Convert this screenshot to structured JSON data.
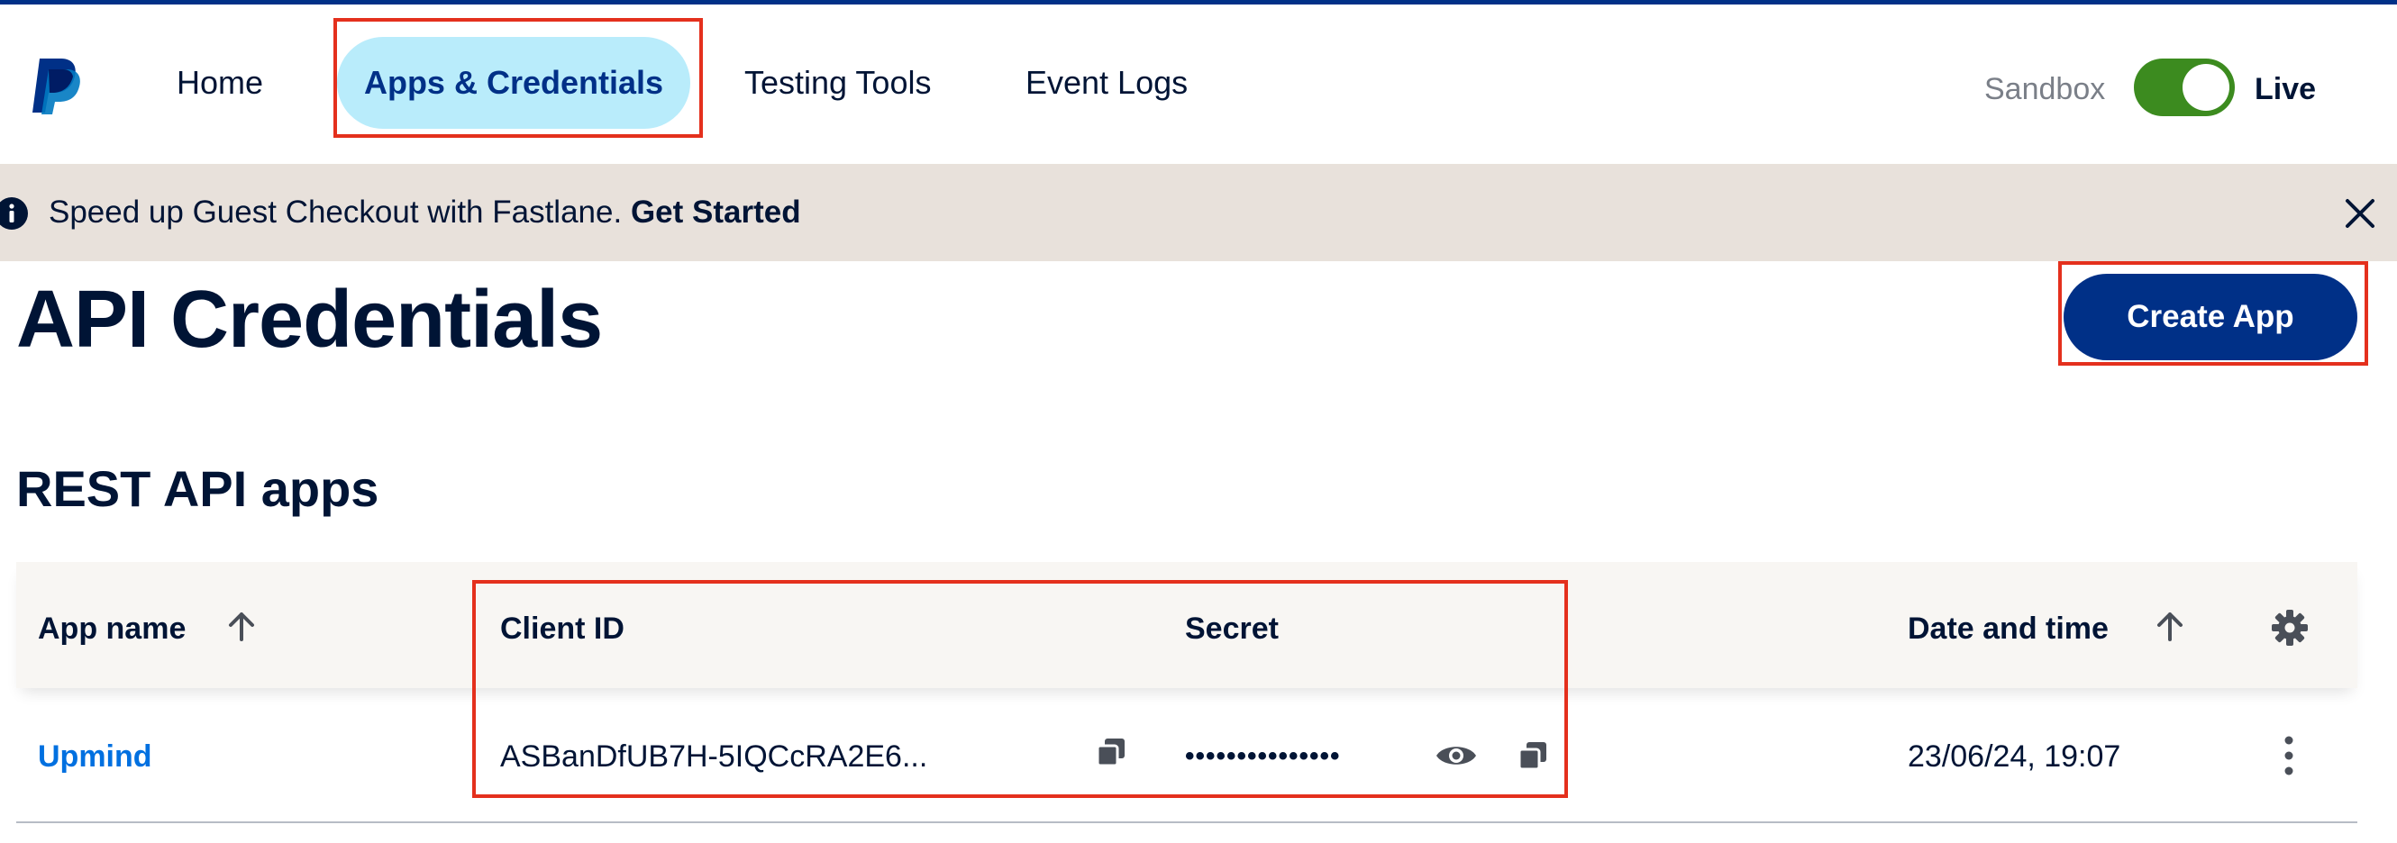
{
  "nav": {
    "items": [
      {
        "label": "Home"
      },
      {
        "label": "Apps & Credentials",
        "active": true
      },
      {
        "label": "Testing Tools"
      },
      {
        "label": "Event Logs"
      }
    ]
  },
  "environment": {
    "sandbox_label": "Sandbox",
    "live_label": "Live",
    "selected": "Live"
  },
  "banner": {
    "text": "Speed up Guest Checkout with Fastlane. ",
    "link": "Get Started"
  },
  "page": {
    "title": "API Credentials",
    "create_button": "Create App",
    "section_title": "REST API apps"
  },
  "table": {
    "headers": {
      "app_name": "App name",
      "client_id": "Client ID",
      "secret": "Secret",
      "date_time": "Date and time"
    },
    "rows": [
      {
        "app_name": "Upmind",
        "client_id": "ASBanDfUB7H-5IQCcRA2E6...",
        "secret": "•••••••••••••••",
        "date_time": "23/06/24, 19:07"
      }
    ]
  },
  "colors": {
    "brand_navy": "#003087",
    "active_tab_bg": "#b9ecfb",
    "toggle_on": "#3c8b1f",
    "banner_bg": "#e8e1db",
    "link_blue": "#0070e0",
    "annotation_red": "#e4301d"
  },
  "icons": [
    "paypal-logo",
    "info-icon",
    "close-icon",
    "arrow-up-icon",
    "gear-icon",
    "copy-icon",
    "eye-icon",
    "kebab-menu-icon"
  ]
}
